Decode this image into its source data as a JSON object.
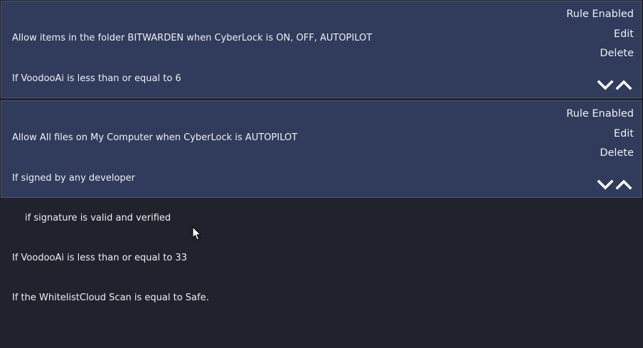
{
  "rules": [
    {
      "lines": [
        {
          "text": "Allow items in the folder BITWARDEN when CyberLock is ON, OFF, AUTOPILOT",
          "indent": false
        },
        {
          "text": "If VoodooAi is less than or equal to 6",
          "indent": false
        }
      ],
      "actions": {
        "status_label": "Rule Enabled",
        "edit_label": "Edit",
        "delete_label": "Delete"
      },
      "arrows": {
        "down_icon": "chevron-down-icon",
        "up_icon": "chevron-up-icon"
      }
    },
    {
      "lines": [
        {
          "text": "Allow All files on My Computer when CyberLock is AUTOPILOT",
          "indent": false
        },
        {
          "text": "If signed by any developer",
          "indent": false
        },
        {
          "text": "if signature is valid and verified",
          "indent": true
        },
        {
          "text": "If VoodooAi is less than or equal to 33",
          "indent": false
        },
        {
          "text": "If the WhitelistCloud Scan is equal to Safe.",
          "indent": false
        }
      ],
      "actions": {
        "status_label": "Rule Enabled",
        "edit_label": "Edit",
        "delete_label": "Delete"
      },
      "arrows": {
        "down_icon": "chevron-down-icon",
        "up_icon": "chevron-up-icon"
      }
    }
  ],
  "colors": {
    "background": "#20222c",
    "card": "#313b5b",
    "card_border": "#4e5770",
    "text": "#eef0f5"
  },
  "cursor_icon": "mouse-pointer-icon"
}
